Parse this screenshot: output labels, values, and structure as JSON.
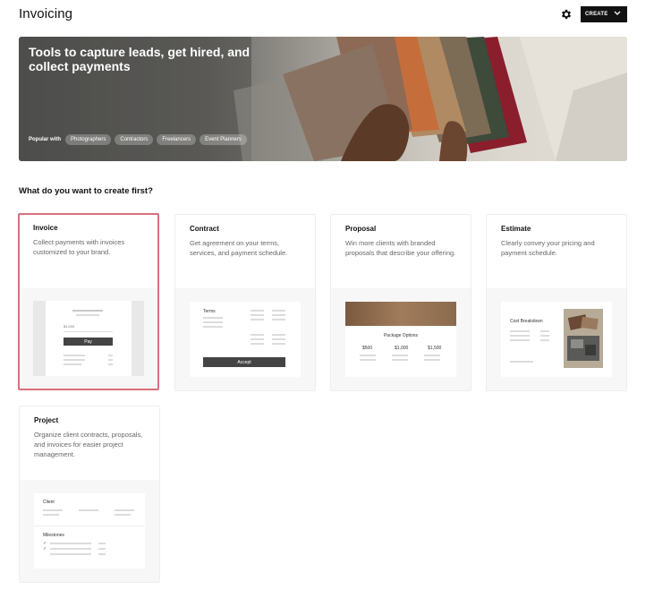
{
  "header": {
    "title": "Invoicing",
    "create_label": "CREATE",
    "icons": {
      "settings": "gear-icon",
      "create_chevron": "chevron-down-icon"
    }
  },
  "hero": {
    "title": "Tools to capture leads, get hired, and collect payments",
    "popular_label": "Popular with",
    "tags": [
      "Photographers",
      "Contractors",
      "Freelancers",
      "Event Planners"
    ]
  },
  "section_title": "What do you want to create first?",
  "cards": [
    {
      "title": "Invoice",
      "description": "Collect payments with invoices customized to your brand.",
      "preview": {
        "amount": "$1,000",
        "button": "Pay"
      }
    },
    {
      "title": "Contract",
      "description": "Get agreement on your terms, services, and payment schedule.",
      "preview": {
        "heading": "Terms",
        "button": "Accept"
      }
    },
    {
      "title": "Proposal",
      "description": "Win more clients with branded proposals that describe your offering.",
      "preview": {
        "heading": "Package Options",
        "prices": [
          "$500",
          "$1,000",
          "$1,500"
        ]
      }
    },
    {
      "title": "Estimate",
      "description": "Clearly convey your pricing and payment schedule.",
      "preview": {
        "heading": "Cost Breakdown"
      }
    },
    {
      "title": "Project",
      "description": "Organize client contracts, proposals, and invoices for easier project management.",
      "preview": {
        "client_label": "Client",
        "milestones_label": "Milestones"
      }
    }
  ],
  "colors": {
    "selected_border": "#d9707e",
    "button_dark": "#121212",
    "preview_bg": "#f7f7f7"
  }
}
